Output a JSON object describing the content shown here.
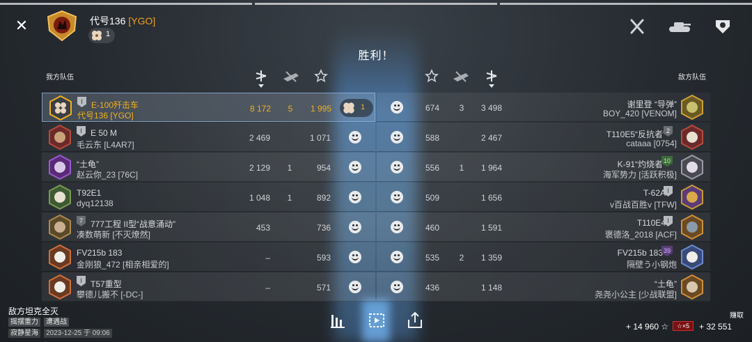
{
  "header": {
    "close_label": "✕",
    "player_name": "代号136",
    "player_clan": "[YGO]",
    "clover_count": "1",
    "result": "胜利！",
    "my_team_label": "我方队伍",
    "enemy_team_label": "敌方队伍"
  },
  "allies": [
    {
      "tier": "I",
      "tank": "E-100歼击车",
      "player": "代号136 [YGO]",
      "damage": "8 172",
      "kills": "5",
      "xp": "1 995",
      "badge": "1",
      "me": true
    },
    {
      "tier": "I",
      "tank": "E 50 M",
      "player": "毛云东 [L4AR7]",
      "damage": "2 469",
      "kills": "",
      "xp": "1 071"
    },
    {
      "tier": "",
      "tank": "“土龟”",
      "player": "赵云你_23 [76C]",
      "damage": "2 129",
      "kills": "1",
      "xp": "954"
    },
    {
      "tier": "",
      "tank": "T92E1",
      "player": "dyq12138",
      "damage": "1 048",
      "kills": "1",
      "xp": "892"
    },
    {
      "tier": "7",
      "tank": "777工程 II型“战意涌动”",
      "player": "凑数萌新 [不灭燎然]",
      "damage": "453",
      "kills": "",
      "xp": "736"
    },
    {
      "tier": "",
      "tank": "FV215b 183",
      "player": "金刚狼_472 [相亲相爱的]",
      "damage": "–",
      "kills": "",
      "xp": "593"
    },
    {
      "tier": "I",
      "tank": "T57重型",
      "player": "攀德儿搬不 [-DC-]",
      "damage": "–",
      "kills": "",
      "xp": "571"
    }
  ],
  "enemies": [
    {
      "tier": "",
      "tank": "谢里登 “导弹”",
      "player": "BOY_420 [VENOM]",
      "damage": "674",
      "kills": "3",
      "xp": "3 498"
    },
    {
      "tier": "2",
      "tank": "T110E5“反抗者”",
      "player": "cataaa [0754]",
      "damage": "588",
      "kills": "",
      "xp": "2 467"
    },
    {
      "tier": "10",
      "tank": "K-91“灼烧者”",
      "player": "海军势力 [活跃积极]",
      "damage": "556",
      "kills": "1",
      "xp": "1 964"
    },
    {
      "tier": "I",
      "tank": "T-62A",
      "player": "v百战百胜v [TFW]",
      "damage": "509",
      "kills": "",
      "xp": "1 656"
    },
    {
      "tier": "I",
      "tank": "T110E4",
      "player": "褒德洛_2018 [ACF]",
      "damage": "460",
      "kills": "",
      "xp": "1 591"
    },
    {
      "tier": "39",
      "tank": "FV215b 183",
      "player": "隔壁う小钢炮",
      "damage": "535",
      "kills": "2",
      "xp": "1 359"
    },
    {
      "tier": "",
      "tank": "“土龟”",
      "player": "尧尧小公主 [少战联盟]",
      "damage": "436",
      "kills": "",
      "xp": "1 148"
    }
  ],
  "footer": {
    "result_reason": "敌方坦克全灭",
    "mode_tag": "摇摆重力",
    "battle_type_tag": "遭遇战",
    "map_tag": "寂静星海",
    "date_tag": "2023-12-25 于 09:06",
    "earn_title": "赚取",
    "credits_earned": "+ 14 960",
    "premium_multiplier": "☆×5",
    "xp_earned": "+ 32 551"
  },
  "colors": {
    "accent_gold": "#f2b01e",
    "row_highlight_border": "#96bee8"
  },
  "icons": [
    "close-icon",
    "crossed-swords-icon",
    "tank-icon",
    "medal-icon",
    "clover-icon",
    "damage-icon",
    "kills-icon",
    "star-icon",
    "bar-chart-icon",
    "replay-icon",
    "share-icon",
    "smile-icon"
  ]
}
